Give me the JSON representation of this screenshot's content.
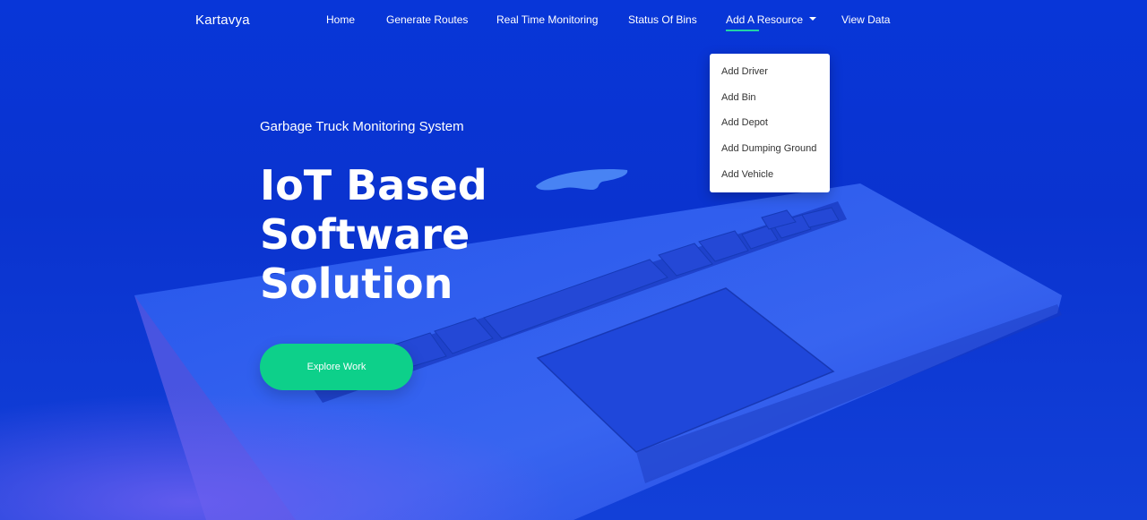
{
  "brand": "Kartavya",
  "nav": {
    "home": "Home",
    "generate_routes": "Generate Routes",
    "real_time_monitoring": "Real Time Monitoring",
    "status_of_bins": "Status Of Bins",
    "add_a_resource": "Add A Resource",
    "view_data": "View Data"
  },
  "dropdown": {
    "items": [
      "Add Driver",
      "Add Bin",
      "Add Depot",
      "Add Dumping Ground",
      "Add Vehicle"
    ]
  },
  "hero": {
    "subtitle": "Garbage Truck Monitoring System",
    "headline": [
      "IoT Based",
      "Software",
      "Solution"
    ],
    "cta": "Explore Work"
  },
  "colors": {
    "background": "#0a33cf",
    "accent": "#0dd08a",
    "nav_underline": "#22d3a6"
  }
}
